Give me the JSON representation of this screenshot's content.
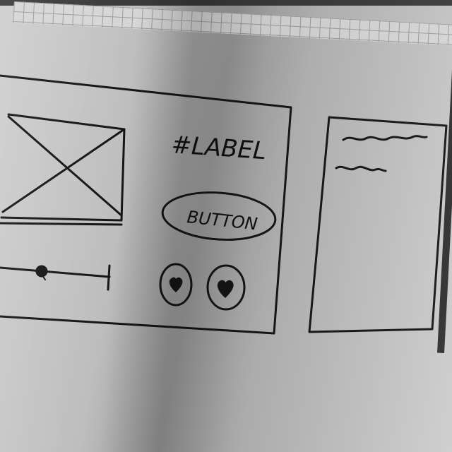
{
  "sketch": {
    "label_text": "#LABEL",
    "button_label": "BUTTON",
    "slider_value": 0.38,
    "icons": [
      "image-placeholder-icon",
      "heart-icon",
      "heart-icon"
    ]
  }
}
